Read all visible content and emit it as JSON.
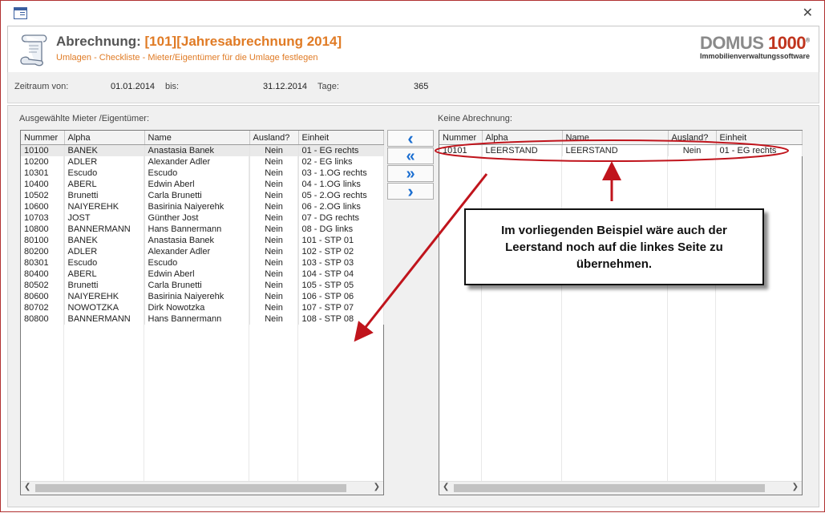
{
  "window": {
    "close_label": "✕"
  },
  "header": {
    "title_prefix": "Abrechnung:",
    "title_highlight": "[101][Jahresabrechnung 2014]",
    "subtitle": "Umlagen - Checkliste - Mieter/Eigentümer für die Umlage festlegen",
    "logo_main": "DOMUS",
    "logo_number": "1000",
    "logo_reg": "®",
    "logo_sub": "Immobilienverwaltungssoftware"
  },
  "period": {
    "from_label": "Zeitraum von:",
    "from_value": "01.01.2014",
    "to_label": "bis:",
    "to_value": "31.12.2014",
    "days_label": "Tage:",
    "days_value": "365"
  },
  "left": {
    "label": "Ausgewählte Mieter /Eigentümer:",
    "columns": [
      "Nummer",
      "Alpha",
      "Name",
      "Ausland?",
      "Einheit"
    ],
    "rows": [
      [
        "10100",
        "BANEK",
        "Anastasia Banek",
        "Nein",
        "01 - EG rechts"
      ],
      [
        "10200",
        "ADLER",
        "Alexander Adler",
        "Nein",
        "02 - EG links"
      ],
      [
        "10301",
        "Escudo",
        "Escudo",
        "Nein",
        "03 - 1.OG rechts"
      ],
      [
        "10400",
        "ABERL",
        "Edwin Aberl",
        "Nein",
        "04 - 1.OG links"
      ],
      [
        "10502",
        "Brunetti",
        "Carla Brunetti",
        "Nein",
        "05 - 2.OG rechts"
      ],
      [
        "10600",
        "NAIYEREHK",
        "Basirinia Naiyerehk",
        "Nein",
        "06 - 2.OG links"
      ],
      [
        "10703",
        "JOST",
        "Günther Jost",
        "Nein",
        "07 - DG rechts"
      ],
      [
        "10800",
        "BANNERMANN",
        "Hans Bannermann",
        "Nein",
        "08 - DG links"
      ],
      [
        "80100",
        "BANEK",
        "Anastasia Banek",
        "Nein",
        "101 - STP 01"
      ],
      [
        "80200",
        "ADLER",
        "Alexander Adler",
        "Nein",
        "102 - STP 02"
      ],
      [
        "80301",
        "Escudo",
        "Escudo",
        "Nein",
        "103 - STP 03"
      ],
      [
        "80400",
        "ABERL",
        "Edwin Aberl",
        "Nein",
        "104 - STP 04"
      ],
      [
        "80502",
        "Brunetti",
        "Carla Brunetti",
        "Nein",
        "105 - STP 05"
      ],
      [
        "80600",
        "NAIYEREHK",
        "Basirinia Naiyerehk",
        "Nein",
        "106 - STP 06"
      ],
      [
        "80702",
        "NOWOTZKA",
        "Dirk Nowotzka",
        "Nein",
        "107 - STP 07"
      ],
      [
        "80800",
        "BANNERMANN",
        "Hans Bannermann",
        "Nein",
        "108 - STP 08"
      ]
    ]
  },
  "right": {
    "label": "Keine Abrechnung:",
    "columns": [
      "Nummer",
      "Alpha",
      "Name",
      "Ausland?",
      "Einheit"
    ],
    "rows": [
      [
        "10101",
        "LEERSTAND",
        "LEERSTAND",
        "Nein",
        "01 - EG rechts"
      ]
    ]
  },
  "buttons": {
    "move_one_left": "‹",
    "move_all_left": "«",
    "move_all_right": "»",
    "move_one_right": "›"
  },
  "callout": {
    "line1": "Im vorliegenden Beispiel wäre auch der",
    "line2": "Leerstand noch auf die linkes Seite zu",
    "line3": "übernehmen."
  },
  "scroll": {
    "left_arrow": "❮",
    "right_arrow": "❯"
  },
  "colors": {
    "accent": "#e07b25",
    "annotation": "#c0141c",
    "button_arrow": "#1c6fd1"
  }
}
